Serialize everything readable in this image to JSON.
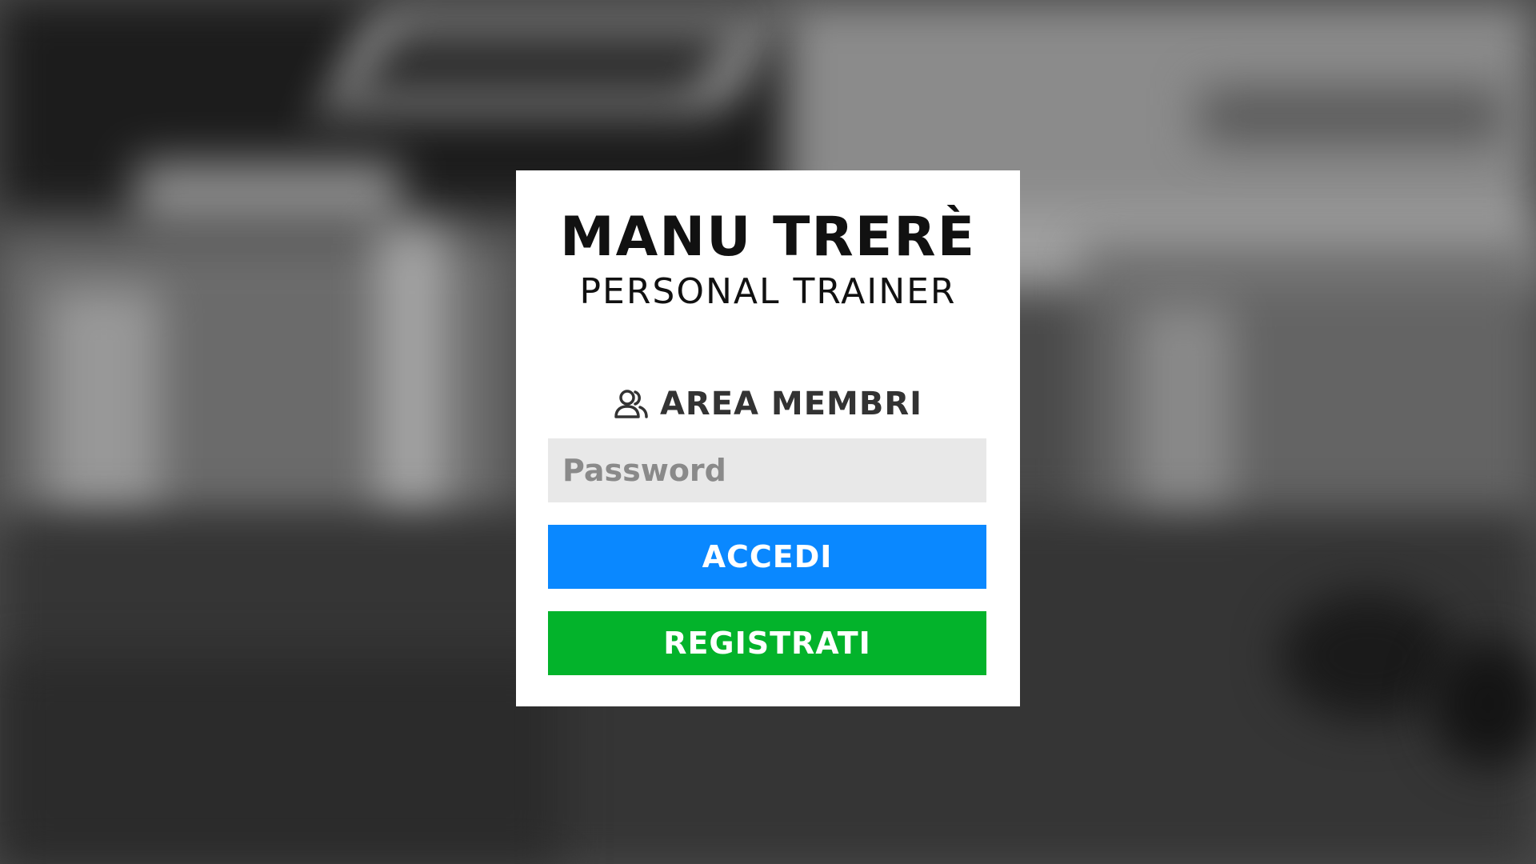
{
  "brand": {
    "name": "MANU TRERÈ",
    "subtitle": "PERSONAL TRAINER"
  },
  "login": {
    "area_label": "AREA MEMBRI",
    "area_icon": "user-icon",
    "password_placeholder": "Password",
    "password_value": "",
    "login_button": "ACCEDI",
    "register_button": "REGISTRATI"
  },
  "colors": {
    "login_button": "#0a88ff",
    "register_button": "#03b32b",
    "input_background": "#e8e8e8",
    "card_background": "#ffffff"
  }
}
